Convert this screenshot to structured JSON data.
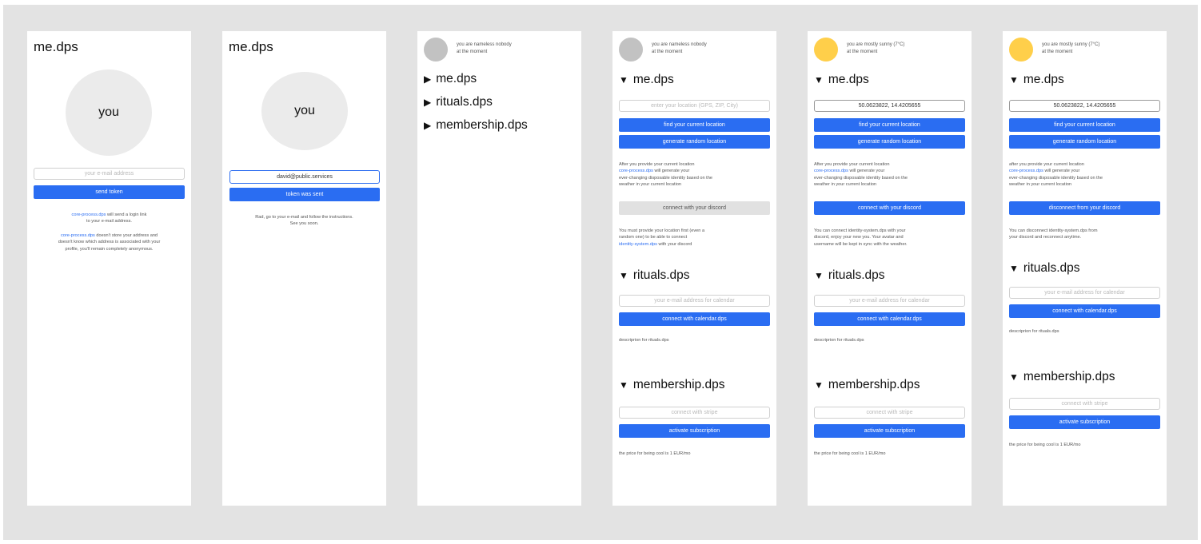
{
  "frame1": {
    "title": "me.dps",
    "avatar_label": "you",
    "email_placeholder": "your e-mail address",
    "send_button": "send token",
    "info1_link": "core-process.dps",
    "info1_text": "will send a login link",
    "info1_line2": "to your e-mail address.",
    "info2_link": "core-process.dps",
    "info2_text": "doesn't store your address and",
    "info2_line2": "doesn't know which address is associated with your",
    "info2_line3": "profile, you'll remain completely anonymous."
  },
  "frame2": {
    "title": "me.dps",
    "avatar_label": "you",
    "email_value": "david@public.services",
    "sent_button": "token was sent",
    "info_line1": "Rad, go to your e-mail and follow the instructions.",
    "info_line2": "See you soon."
  },
  "frame3": {
    "status_line1": "you are nameless nobody",
    "status_line2": "at the moment",
    "sections": [
      {
        "symbol": "▶",
        "label": "me.dps"
      },
      {
        "symbol": "▶",
        "label": "rituals.dps"
      },
      {
        "symbol": "▶",
        "label": "membership.dps"
      }
    ]
  },
  "frame4": {
    "status_line1": "you are nameless nobody",
    "status_line2": "at the moment",
    "section_me": {
      "symbol": "▼",
      "label": "me.dps"
    },
    "location_placeholder": "enter your location (GPS, ZIP, City)",
    "find_button": "find your current location",
    "random_button": "generate random location",
    "loc_info_line1": "After you provide your current location",
    "loc_info_link": "core-process.dps",
    "loc_info_line2": "will generate your",
    "loc_info_line3": "ever-changing disposable identity based on the",
    "loc_info_line4": "weather in your current location",
    "discord_button": "connect with your discord",
    "discord_info_line1": "You must provide your location first (even a",
    "discord_info_line2": "random one) to be able to connect",
    "discord_info_link": "identity-system.dps",
    "discord_info_line3": "with your discord",
    "section_rituals": {
      "symbol": "▼",
      "label": "rituals.dps"
    },
    "calendar_placeholder": "your e-mail address for calendar",
    "calendar_button": "connect with calendar.dps",
    "rituals_desc": "descriprion for rituals.dps",
    "section_membership": {
      "symbol": "▼",
      "label": "membership.dps"
    },
    "stripe_placeholder": "connect with stripe",
    "subscription_button": "activate subscription",
    "price_text": "the price for being cool is 1 EUR/mo"
  },
  "frame5": {
    "status_line1": "you are mostly sunny (7°C)",
    "status_line2": "at the moment",
    "section_me": {
      "symbol": "▼",
      "label": "me.dps"
    },
    "location_value": "50.0623822, 14.4205655",
    "find_button": "find your current location",
    "random_button": "generate random location",
    "loc_info_line1": "After you provide your current location",
    "loc_info_link": "core-process.dps",
    "loc_info_line2": "will generate your",
    "loc_info_line3": "ever-changing disposable identity based on the",
    "loc_info_line4": "weather in your current location",
    "discord_button": "connect with your discord",
    "discord_info_line1": "You can connect identity-system.dps with your",
    "discord_info_line2": "discord, enjoy your new you. Your avatar and",
    "discord_info_line3": "username will be kept in sync with the weather.",
    "section_rituals": {
      "symbol": "▼",
      "label": "rituals.dps"
    },
    "calendar_placeholder": "your e-mail address for calendar",
    "calendar_button": "connect with calendar.dps",
    "rituals_desc": "descriprion for rituals.dps",
    "section_membership": {
      "symbol": "▼",
      "label": "membership.dps"
    },
    "stripe_placeholder": "connect with stripe",
    "subscription_button": "activate subscription",
    "price_text": "the price for being cool is 1 EUR/mo"
  },
  "frame6": {
    "status_line1": "you are mostly sunny (7°C)",
    "status_line2": "at the moment",
    "section_me": {
      "symbol": "▼",
      "label": "me.dps"
    },
    "location_value": "50.0623822, 14.4205655",
    "find_button": "find your current location",
    "random_button": "generate random location",
    "loc_info_line1": "after you provide your current location",
    "loc_info_link": "core-process.dps",
    "loc_info_line2": "will generate your",
    "loc_info_line3": "ever-changing disposable identity based on the",
    "loc_info_line4": "weather in your current location",
    "discord_button": "disconnect from your discord",
    "discord_info_line1": "You can disconnect identity-system.dps from",
    "discord_info_line2": "your discord and reconnect anytime.",
    "section_rituals": {
      "symbol": "▼",
      "label": "rituals.dps"
    },
    "calendar_placeholder": "your e-mail address for calendar",
    "calendar_button": "connect with calendar.dps",
    "rituals_desc": "descriprion for rituals.dps",
    "section_membership": {
      "symbol": "▼",
      "label": "membership.dps"
    },
    "stripe_placeholder": "connect with stripe",
    "subscription_button": "activate subscription",
    "price_text": "the price for being cool is 1 EUR/mo"
  },
  "colors": {
    "canvas": "#e3e3e3",
    "accent": "#2a6df2",
    "avatar_grey": "#c2c2c2",
    "avatar_sun": "#ffcf4a"
  }
}
